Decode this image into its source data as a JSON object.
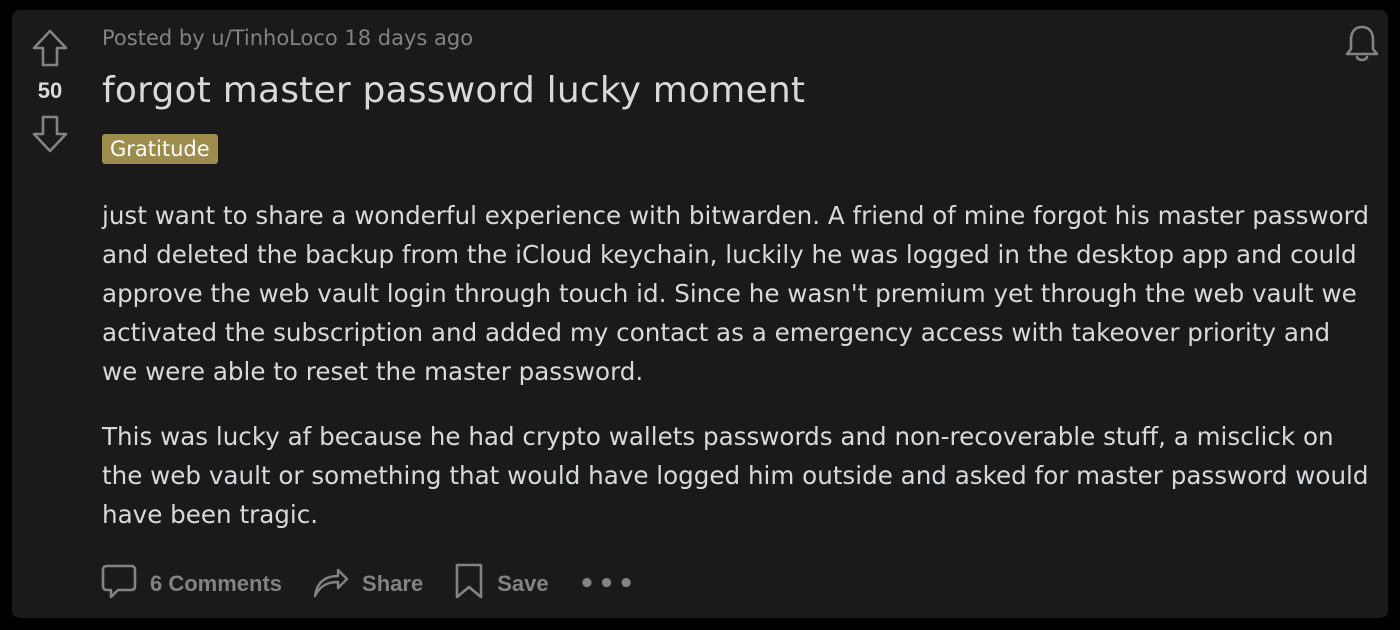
{
  "post": {
    "meta": "Posted by u/TinhoLoco 18 days ago",
    "score": "50",
    "title": "forgot master password lucky moment",
    "flair": "Gratitude",
    "paragraphs": [
      "just want to share a wonderful experience with bitwarden. A friend of mine forgot his master password and deleted the backup from the iCloud keychain, luckily he was logged in the desktop app and could approve the web vault login through touch id. Since he wasn't premium yet through the web vault we activated the subscription and added my contact as a emergency access with takeover priority and we were able to reset the master password.",
      "This was lucky af because he had crypto wallets passwords and non-recoverable stuff, a misclick on the web vault or something that would have logged him outside and asked for master password would have been tragic."
    ]
  },
  "actions": {
    "comments_label": "6 Comments",
    "share_label": "Share",
    "save_label": "Save",
    "more_label": "•••"
  },
  "icons": {
    "upvote": "upvote-arrow-icon",
    "downvote": "downvote-arrow-icon",
    "bell": "bell-icon",
    "comment": "comment-bubble-icon",
    "share": "share-arrow-icon",
    "save": "bookmark-icon"
  },
  "colors": {
    "background": "#1a1a1b",
    "text": "#d7dadc",
    "muted": "#818384",
    "flair": "#9e8c4d"
  }
}
